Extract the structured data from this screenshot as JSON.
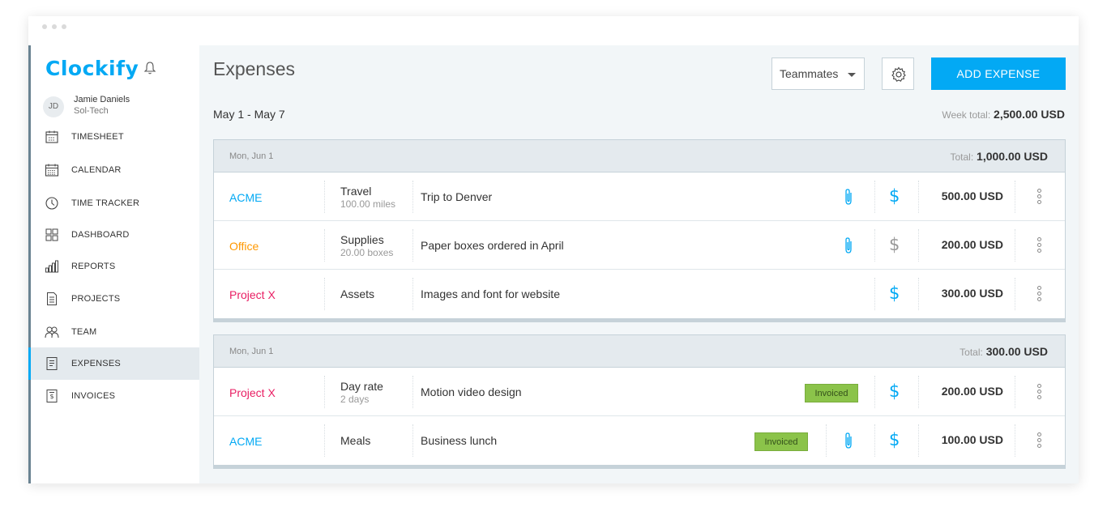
{
  "app": {
    "logo": "Clockify",
    "user": {
      "initials": "JD",
      "name": "Jamie Daniels",
      "org": "Sol-Tech"
    },
    "accent_color": "#03a9f4"
  },
  "sidebar": {
    "items": [
      {
        "label": "TIMESHEET",
        "icon": "timesheet-icon"
      },
      {
        "label": "CALENDAR",
        "icon": "calendar-icon"
      },
      {
        "label": "TIME TRACKER",
        "icon": "clock-icon"
      },
      {
        "label": "DASHBOARD",
        "icon": "dashboard-icon"
      },
      {
        "label": "REPORTS",
        "icon": "bar-chart-icon"
      },
      {
        "label": "PROJECTS",
        "icon": "document-icon"
      },
      {
        "label": "TEAM",
        "icon": "team-icon"
      },
      {
        "label": "EXPENSES",
        "icon": "receipt-icon",
        "active": true
      },
      {
        "label": "INVOICES",
        "icon": "invoice-icon"
      }
    ]
  },
  "header": {
    "title": "Expenses",
    "teammates_label": "Teammates",
    "add_button": "ADD EXPENSE"
  },
  "summary": {
    "range": "May 1 - May 7",
    "week_total_label": "Week total:",
    "week_total_value": "2,500.00 USD"
  },
  "groups": [
    {
      "date": "Mon, Jun 1",
      "total_label": "Total:",
      "total_value": "1,000.00 USD",
      "rows": [
        {
          "project": "ACME",
          "project_color": "#03a9f4",
          "category": "Travel",
          "sub": "100.00 miles",
          "description": "Trip to Denver",
          "attachment": true,
          "billable": true,
          "amount": "500.00 USD"
        },
        {
          "project": "Office",
          "project_color": "#ff9800",
          "category": "Supplies",
          "sub": "20.00 boxes",
          "description": "Paper boxes ordered in April",
          "attachment": true,
          "billable": false,
          "amount": "200.00 USD"
        },
        {
          "project": "Project X",
          "project_color": "#e91e63",
          "category": "Assets",
          "sub": "",
          "description": "Images and font for website",
          "attachment": false,
          "billable": true,
          "amount": "300.00 USD"
        }
      ]
    },
    {
      "date": "Mon, Jun 1",
      "total_label": "Total:",
      "total_value": "300.00 USD",
      "rows": [
        {
          "project": "Project X",
          "project_color": "#e91e63",
          "category": "Day rate",
          "sub": "2 days",
          "description": "Motion video design",
          "badge": "Invoiced",
          "attachment": false,
          "billable": true,
          "amount": "200.00 USD"
        },
        {
          "project": "ACME",
          "project_color": "#03a9f4",
          "category": "Meals",
          "sub": "",
          "description": "Business lunch",
          "badge": "Invoiced",
          "attachment": true,
          "billable": true,
          "amount": "100.00 USD"
        }
      ]
    }
  ]
}
